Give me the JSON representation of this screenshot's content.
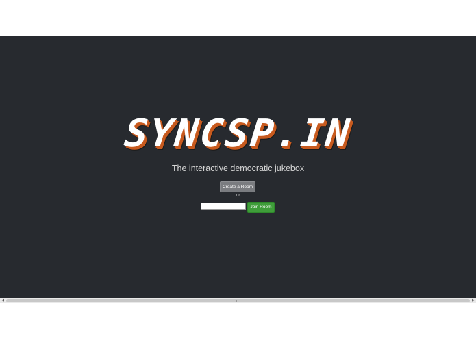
{
  "logo": {
    "text": "SYNCSP.IN"
  },
  "tagline": "The interactive democratic jukebox",
  "actions": {
    "create_label": "Create a Room",
    "or_label": "or",
    "join_label": "Join Room",
    "room_input_value": "",
    "room_input_placeholder": ""
  },
  "icons": {
    "scroll_left": "scroll-left-arrow-icon",
    "scroll_right": "scroll-right-arrow-icon"
  },
  "colors": {
    "background": "#272a2f",
    "logo_shadow": "#c85a1e",
    "create_button": "#7a7c80",
    "join_button": "#3f9d3a"
  }
}
